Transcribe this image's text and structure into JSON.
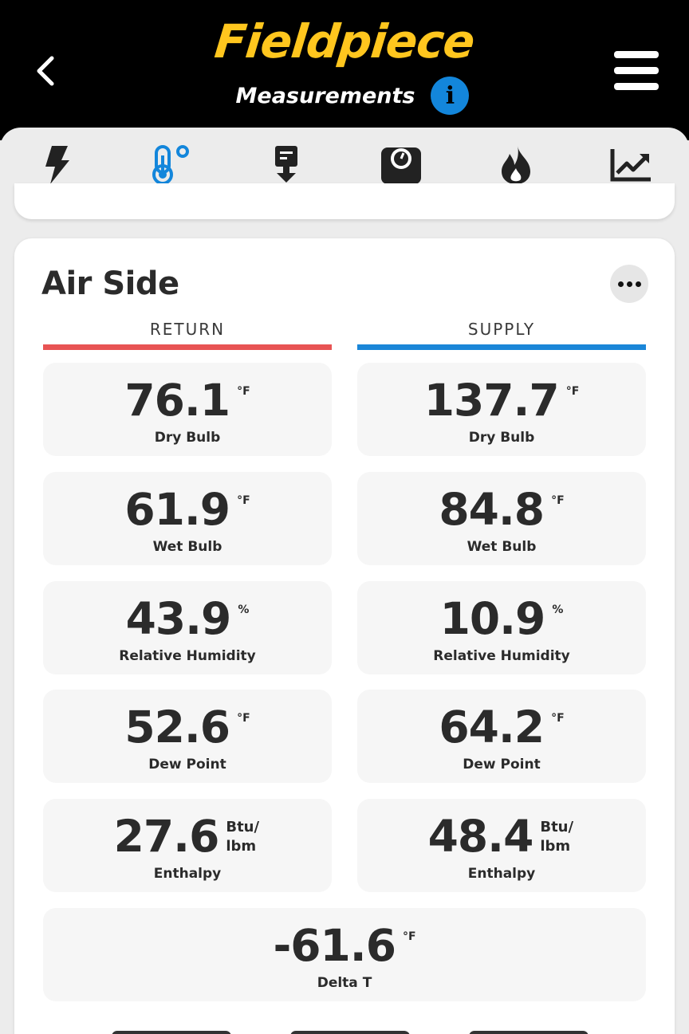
{
  "header": {
    "brand": "Fieldpiece",
    "subtitle": "Measurements",
    "info_glyph": "i",
    "colors": {
      "background": "#000000",
      "brand": "#ffc61e",
      "info": "#1386db"
    }
  },
  "tabs": [
    {
      "icon": "lightning-bolt-icon",
      "active": false
    },
    {
      "icon": "thermometer-icon",
      "active": true
    },
    {
      "icon": "download-probe-icon",
      "active": false
    },
    {
      "icon": "gauge-icon",
      "active": false
    },
    {
      "icon": "flame-icon",
      "active": false
    },
    {
      "icon": "trend-chart-icon",
      "active": false
    }
  ],
  "air_side": {
    "title": "Air Side",
    "return": {
      "header": "RETURN",
      "color": "#e85454",
      "dry_bulb": {
        "value": "76.1",
        "unit": "°F",
        "label": "Dry Bulb"
      },
      "wet_bulb": {
        "value": "61.9",
        "unit": "°F",
        "label": "Wet Bulb"
      },
      "rh": {
        "value": "43.9",
        "unit": "%",
        "label": "Relative Humidity"
      },
      "dew_point": {
        "value": "52.6",
        "unit": "°F",
        "label": "Dew Point"
      },
      "enthalpy": {
        "value": "27.6",
        "unit_top": "Btu/",
        "unit_bottom": "lbm",
        "label": "Enthalpy"
      }
    },
    "supply": {
      "header": "SUPPLY",
      "color": "#1a86d8",
      "dry_bulb": {
        "value": "137.7",
        "unit": "°F",
        "label": "Dry Bulb"
      },
      "wet_bulb": {
        "value": "84.8",
        "unit": "°F",
        "label": "Wet Bulb"
      },
      "rh": {
        "value": "10.9",
        "unit": "%",
        "label": "Relative Humidity"
      },
      "dew_point": {
        "value": "64.2",
        "unit": "°F",
        "label": "Dew Point"
      },
      "enthalpy": {
        "value": "48.4",
        "unit_top": "Btu/",
        "unit_bottom": "lbm",
        "label": "Enthalpy"
      }
    },
    "delta_t": {
      "value": "-61.6",
      "unit": "°F",
      "label": "Delta T"
    }
  }
}
